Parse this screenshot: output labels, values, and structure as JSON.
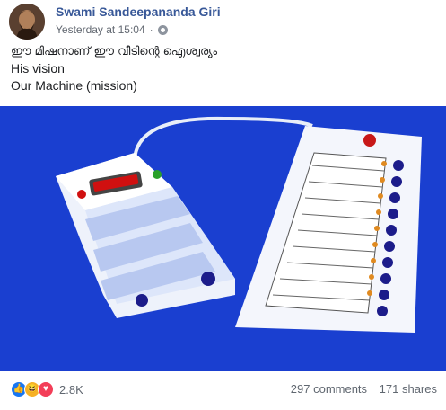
{
  "post": {
    "author": "Swami Sandeepananda Giri",
    "timestamp": "Yesterday at 15:04",
    "privacy_icon": "globe-icon",
    "text_lines": [
      "ഈ മിഷനാണ് ഈ വീടിന്റെ ഐശ്വര്യം",
      "His vision",
      "Our Machine (mission)"
    ]
  },
  "image": {
    "subject": "electronic voting machine",
    "background_color": "#1a3fd0"
  },
  "engagement": {
    "reaction_icons": [
      "like-icon",
      "haha-icon",
      "love-icon"
    ],
    "reaction_count": "2.8K",
    "comments": "297 comments",
    "shares": "171 shares"
  }
}
